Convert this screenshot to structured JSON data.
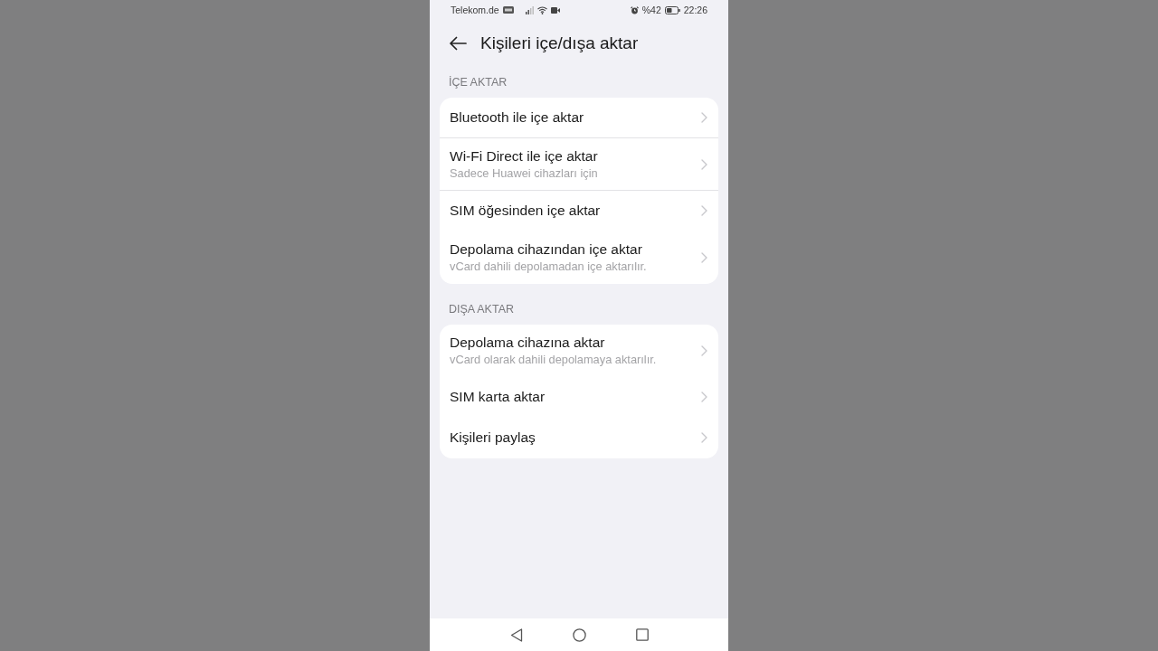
{
  "status_bar": {
    "carrier": "Telekom.de",
    "battery_percent": "%42",
    "time": "22:26"
  },
  "header": {
    "title": "Kişileri içe/dışa aktar"
  },
  "sections": [
    {
      "heading": "İÇE AKTAR",
      "items": [
        {
          "title": "Bluetooth ile içe aktar",
          "divider": true
        },
        {
          "title": "Wi-Fi Direct ile içe aktar",
          "subtitle": "Sadece Huawei cihazları için",
          "divider": true
        },
        {
          "title": "SIM öğesinden içe aktar",
          "divider": false
        },
        {
          "title": "Depolama cihazından içe aktar",
          "subtitle": "vCard dahili depolamadan içe aktarılır.",
          "divider": false
        }
      ]
    },
    {
      "heading": "DIŞA AKTAR",
      "items": [
        {
          "title": "Depolama cihazına aktar",
          "subtitle": "vCard olarak dahili depolamaya aktarılır.",
          "divider": false
        },
        {
          "title": "SIM karta aktar",
          "divider": false
        },
        {
          "title": "Kişileri paylaş",
          "divider": false
        }
      ]
    }
  ]
}
